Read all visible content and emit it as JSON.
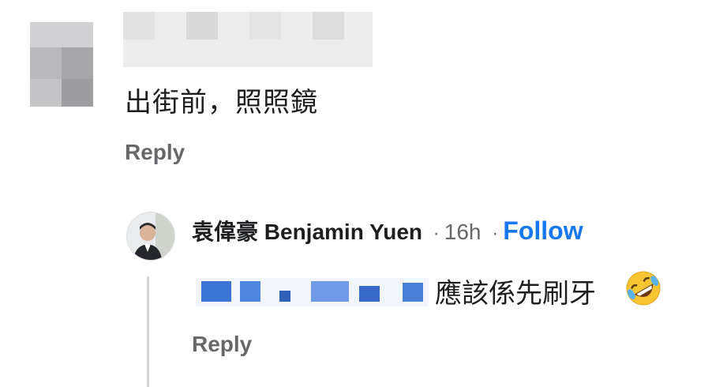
{
  "parent_comment": {
    "text": "出街前，照照鏡",
    "reply_label": "Reply"
  },
  "child_comment": {
    "author": "袁偉豪 Benjamin Yuen",
    "separator": "·",
    "time": "16h",
    "follow_label": "Follow",
    "text": "應該係先刷牙",
    "emoji": "rolling-on-floor-laughing-emoji",
    "reply_label": "Reply"
  },
  "colors": {
    "link_blue": "#1877f2",
    "meta_gray": "#65676b",
    "text": "#1c1e21"
  }
}
